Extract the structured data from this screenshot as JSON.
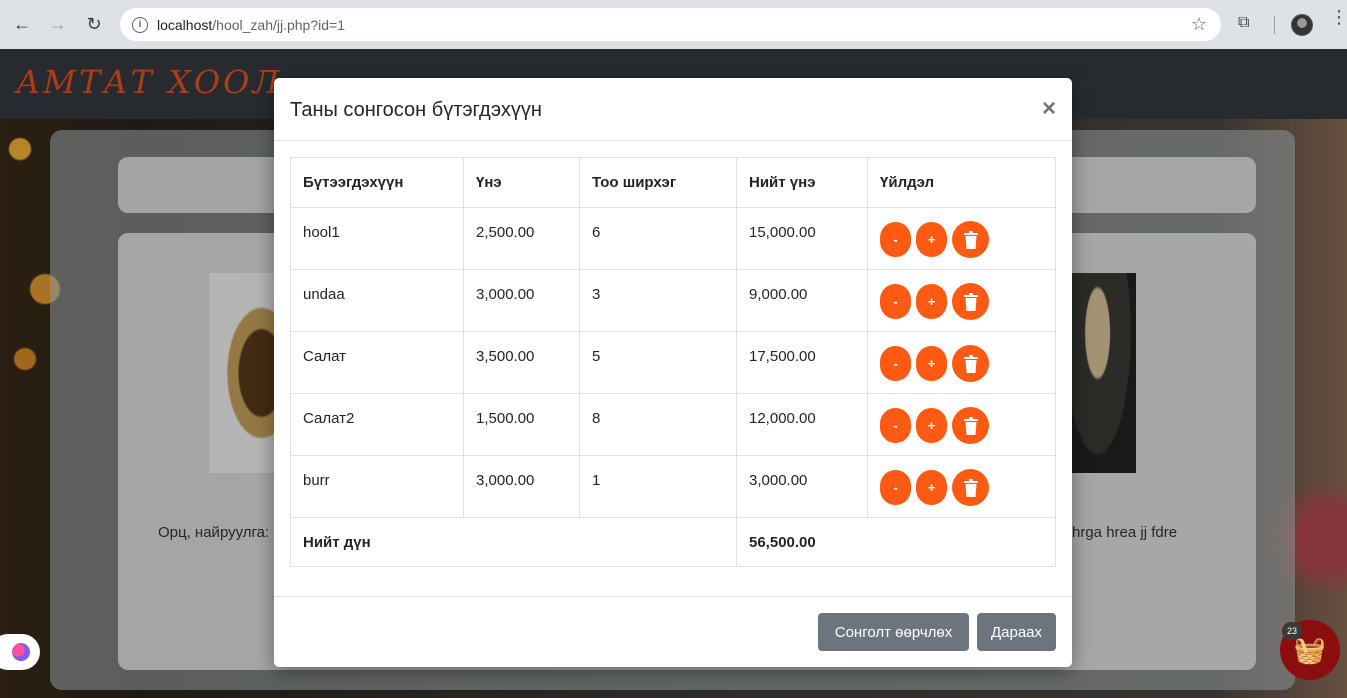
{
  "browser": {
    "url_host": "localhost",
    "url_path": "/hool_zah/jj.php?id=1"
  },
  "site": {
    "logo": "АМТАТ ХООЛ",
    "bg_text_left": "Орц, найруулга:",
    "bg_text_right": "hrga hrea jj fdre"
  },
  "modal": {
    "title": "Таны сонгосон бүтэгдэхүүн",
    "close": "×",
    "columns": [
      "Бүтээгдэхүүн",
      "Үнэ",
      "Тоо ширхэг",
      "Нийт үнэ",
      "Үйлдэл"
    ],
    "rows": [
      {
        "name": "hool1",
        "price": "2,500.00",
        "qty": "6",
        "total": "15,000.00"
      },
      {
        "name": "undaa",
        "price": "3,000.00",
        "qty": "3",
        "total": "9,000.00"
      },
      {
        "name": "Салат",
        "price": "3,500.00",
        "qty": "5",
        "total": "17,500.00"
      },
      {
        "name": "Салат2",
        "price": "1,500.00",
        "qty": "8",
        "total": "12,000.00"
      },
      {
        "name": "burr",
        "price": "3,000.00",
        "qty": "1",
        "total": "3,000.00"
      }
    ],
    "minus_label": "-",
    "plus_label": "+",
    "total_label": "Нийт дүн",
    "total_value": "56,500.00",
    "change_button": "Сонголт өөрчлөх",
    "next_button": "Дараах"
  },
  "cart_badge": "23",
  "colors": {
    "accent": "#ff5a14",
    "secondary": "#6c757d",
    "header": "#343a40"
  }
}
